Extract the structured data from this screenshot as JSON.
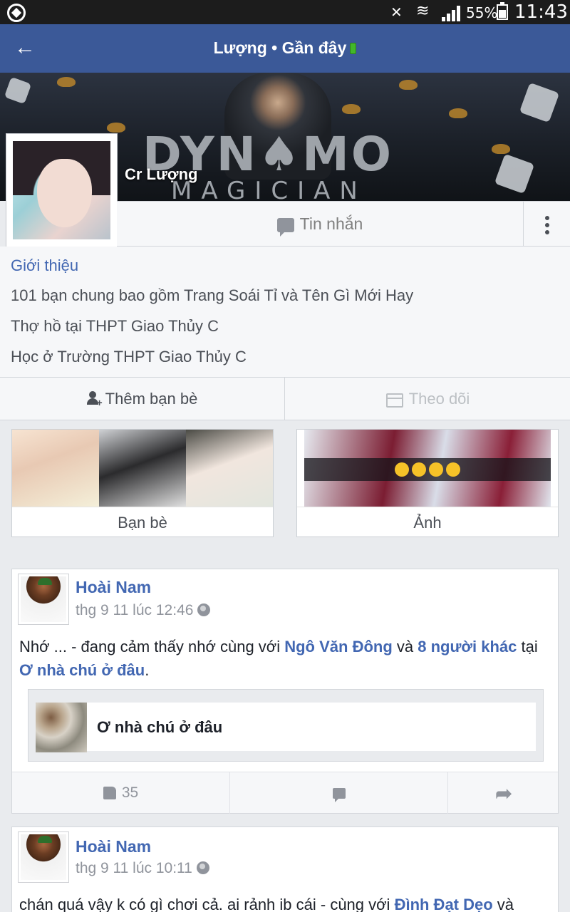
{
  "status_bar": {
    "battery": "55%",
    "time": "11:43"
  },
  "nav": {
    "title": "Lượng • Gần đây"
  },
  "cover": {
    "title": "DYN♠MO",
    "subtitle": "MAGICIAN"
  },
  "profile": {
    "name": "Cr Lượng"
  },
  "actions": {
    "message_label": "Tin nhắn"
  },
  "intro": {
    "title": "Giới thiệu",
    "lines": [
      "101 bạn chung bao gồm Trang Soái Tỉ và Tên Gì Mới Hay",
      "Thợ hồ tại THPT Giao Thủy C",
      "Học ở Trường THPT Giao Thủy C"
    ]
  },
  "friend_actions": {
    "add_friend": "Thêm bạn bè",
    "follow": "Theo dõi"
  },
  "cards": {
    "friends": "Bạn bè",
    "photos": "Ảnh"
  },
  "posts": [
    {
      "author": "Hoài Nam",
      "time": "thg 9 11 lúc 12:46",
      "text_prefix": "Nhớ ... - đang  cảm thấy nhớ cùng với ",
      "tag1": "Ngô Văn Đông",
      "text_mid": " và ",
      "tag2": "8 người khác",
      "text_at": " tại ",
      "place": "Ơ nhà chú ở đâu",
      "text_end": ".",
      "place_card": "Ơ nhà chú ở đâu",
      "likes": "35"
    },
    {
      "author": "Hoài Nam",
      "time": "thg 9 11 lúc 10:11",
      "text_prefix": "chán quá vậy k có gì chơi cả. ai rảnh ib cái - cùng với ",
      "tag1": "Đình Đạt Dẹo",
      "text_end": " và"
    }
  ]
}
